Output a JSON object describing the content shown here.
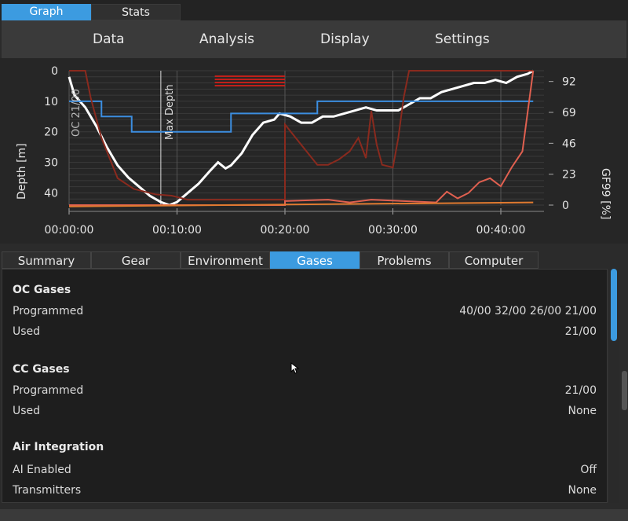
{
  "top_tabs": [
    {
      "label": "Graph",
      "active": true
    },
    {
      "label": "Stats",
      "active": false
    }
  ],
  "menu": {
    "data": "Data",
    "analysis": "Analysis",
    "display": "Display",
    "settings": "Settings"
  },
  "chart_data": {
    "type": "line",
    "ylabel": "Depth [m]",
    "y2label": "GF99 [%]",
    "x_ticks": [
      "00:00:00",
      "00:10:00",
      "00:20:00",
      "00:30:00",
      "00:40:00"
    ],
    "y_ticks": [
      "0",
      "10",
      "20",
      "30",
      "40"
    ],
    "y2_ticks": [
      "92",
      "69",
      "46",
      "23",
      "0"
    ],
    "ylim": [
      0,
      44
    ],
    "y2lim": [
      0,
      100
    ],
    "annotations": [
      "OC 21/00",
      "Max Depth"
    ],
    "x_unit_minutes": [
      0,
      44
    ],
    "series": [
      {
        "color": "#ffffff",
        "points": [
          [
            0,
            2
          ],
          [
            0.5,
            8
          ],
          [
            1.5,
            12
          ],
          [
            2.5,
            18
          ],
          [
            3.5,
            25
          ],
          [
            4.5,
            31
          ],
          [
            5.5,
            35
          ],
          [
            6.5,
            38
          ],
          [
            7.5,
            41
          ],
          [
            8.5,
            43
          ],
          [
            9.3,
            44
          ],
          [
            10,
            43
          ],
          [
            11,
            40
          ],
          [
            12,
            37
          ],
          [
            13,
            33
          ],
          [
            13.8,
            30
          ],
          [
            14.5,
            32
          ],
          [
            15,
            31
          ],
          [
            16,
            27
          ],
          [
            17,
            21
          ],
          [
            18,
            17
          ],
          [
            19,
            16
          ],
          [
            19.5,
            14
          ],
          [
            20.5,
            15
          ],
          [
            21.5,
            17
          ],
          [
            22.5,
            17
          ],
          [
            23,
            16
          ],
          [
            23.5,
            15
          ],
          [
            24.5,
            15
          ],
          [
            25.5,
            14
          ],
          [
            26.5,
            13
          ],
          [
            27.5,
            12
          ],
          [
            28.5,
            13
          ],
          [
            29.5,
            13
          ],
          [
            30.5,
            13
          ],
          [
            31.5,
            11
          ],
          [
            32.5,
            9
          ],
          [
            33.5,
            9
          ],
          [
            34.5,
            7
          ],
          [
            35.5,
            6
          ],
          [
            36.5,
            5
          ],
          [
            37.5,
            4
          ],
          [
            38.5,
            4
          ],
          [
            39.5,
            3
          ],
          [
            40.5,
            4
          ],
          [
            41.5,
            2
          ],
          [
            42.5,
            1
          ],
          [
            43,
            0
          ]
        ]
      },
      {
        "color": "#3c8ee0",
        "points": [
          [
            0,
            10
          ],
          [
            3,
            10
          ],
          [
            3,
            15
          ],
          [
            5.8,
            15
          ],
          [
            5.8,
            20
          ],
          [
            15,
            20
          ],
          [
            15,
            14
          ],
          [
            23,
            14
          ],
          [
            23,
            10
          ],
          [
            43,
            10
          ]
        ]
      },
      {
        "color": "#8a2a1e",
        "points": [
          [
            0,
            0
          ],
          [
            1.5,
            0
          ],
          [
            2,
            20
          ],
          [
            3,
            50
          ],
          [
            4.5,
            80
          ],
          [
            6,
            88
          ],
          [
            8,
            92
          ],
          [
            9.5,
            93
          ],
          [
            11,
            96
          ],
          [
            16,
            96
          ],
          [
            20,
            96
          ],
          [
            20,
            40
          ],
          [
            21,
            50
          ],
          [
            22,
            60
          ],
          [
            23,
            70
          ],
          [
            24,
            70
          ],
          [
            25,
            66
          ],
          [
            26,
            60
          ],
          [
            26.8,
            50
          ],
          [
            27.5,
            65
          ],
          [
            28,
            30
          ],
          [
            28.5,
            55
          ],
          [
            29,
            70
          ],
          [
            30,
            72
          ],
          [
            30.5,
            50
          ],
          [
            31,
            20
          ],
          [
            31.5,
            0
          ],
          [
            43,
            0
          ]
        ]
      },
      {
        "color": "#e06050",
        "points": [
          [
            0,
            100
          ],
          [
            10,
            100
          ],
          [
            20,
            100
          ],
          [
            20,
            97
          ],
          [
            24,
            96
          ],
          [
            26,
            98
          ],
          [
            28,
            96
          ],
          [
            31,
            97
          ],
          [
            34,
            98
          ],
          [
            35,
            90
          ],
          [
            36,
            95
          ],
          [
            37,
            91
          ],
          [
            38,
            83
          ],
          [
            39,
            80
          ],
          [
            40,
            86
          ],
          [
            41,
            72
          ],
          [
            42,
            60
          ],
          [
            42.5,
            30
          ],
          [
            43,
            0
          ]
        ]
      },
      {
        "color": "#e07a30",
        "points": [
          [
            0,
            101
          ],
          [
            43,
            98
          ]
        ]
      }
    ]
  },
  "sub_tabs": [
    {
      "label": "Summary",
      "active": false
    },
    {
      "label": "Gear",
      "active": false
    },
    {
      "label": "Environment",
      "active": false
    },
    {
      "label": "Gases",
      "active": true
    },
    {
      "label": "Problems",
      "active": false
    },
    {
      "label": "Computer",
      "active": false
    }
  ],
  "panel": {
    "oc_title": "OC Gases",
    "oc_programmed_label": "Programmed",
    "oc_programmed_value": "40/00 32/00 26/00 21/00",
    "oc_used_label": "Used",
    "oc_used_value": "21/00",
    "cc_title": "CC Gases",
    "cc_programmed_label": "Programmed",
    "cc_programmed_value": "21/00",
    "cc_used_label": "Used",
    "cc_used_value": "None",
    "air_title": "Air Integration",
    "ai_enabled_label": "AI Enabled",
    "ai_enabled_value": "Off",
    "transmitters_label": "Transmitters",
    "transmitters_value": "None"
  },
  "colors": {
    "accent": "#3c9be0",
    "depth_line": "#ffffff",
    "setpoint_line": "#3c8ee0"
  }
}
